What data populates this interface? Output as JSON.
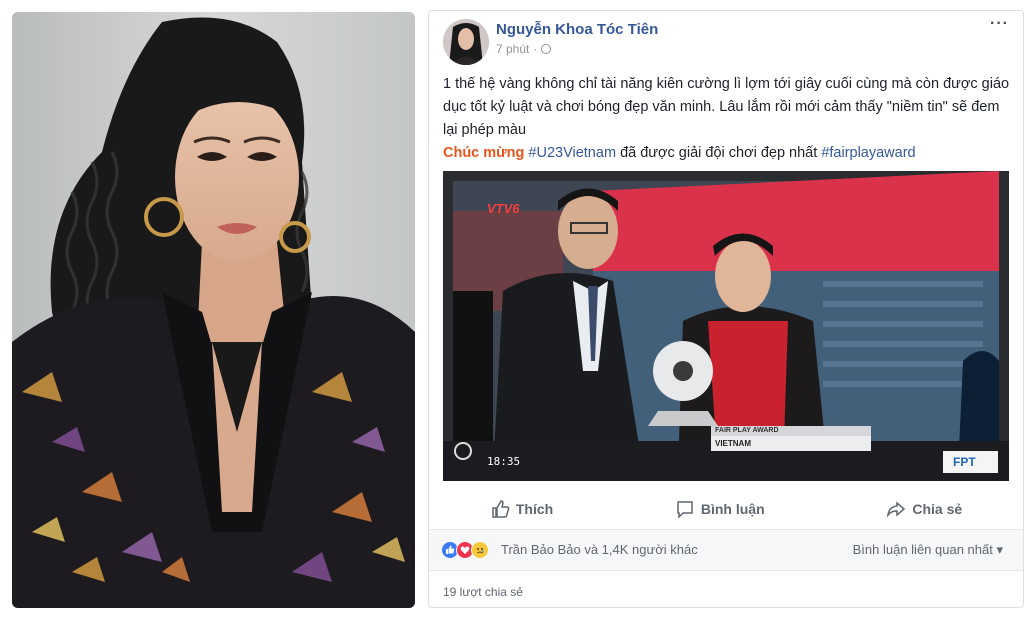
{
  "post": {
    "author": "Nguyễn Khoa Tóc Tiên",
    "time": "7 phút",
    "separator": "·",
    "more": "···",
    "text_main": "1 thế hệ vàng không chỉ tài năng kiên cường lì lợm tới giây cuối cùng mà còn được giáo dục tốt kỷ luật và chơi bóng đẹp văn minh. Lâu lắm rồi mới cảm thấy \"niềm tin\" sẽ đem lại phép màu",
    "congrats": "Chúc mừng",
    "hashtag1": "#U23Vietnam",
    "mid_text": "đã được giải đội chơi đẹp nhất",
    "hashtag2": "#fairplayaward"
  },
  "photo": {
    "channel": "VTV6",
    "time": "18:35",
    "award_title": "FAIR PLAY AWARD",
    "award_team": "VIETNAM",
    "sponsor": "FPT"
  },
  "actions": {
    "like": "Thích",
    "comment": "Bình luận",
    "share": "Chia sẻ"
  },
  "reactions": {
    "summary": "Trần Bảo Bảo và 1,4K người khác",
    "related": "Bình luận liên quan nhất ▾"
  },
  "shares": "19 lượt chia sẻ",
  "colors": {
    "link": "#365899",
    "accent_orange": "#e8541b",
    "text": "#1d2129",
    "muted": "#90949c"
  },
  "icons": [
    "globe-icon",
    "more-icon",
    "like-icon",
    "comment-icon",
    "share-icon",
    "like-reaction-icon",
    "love-reaction-icon",
    "sad-reaction-icon"
  ]
}
